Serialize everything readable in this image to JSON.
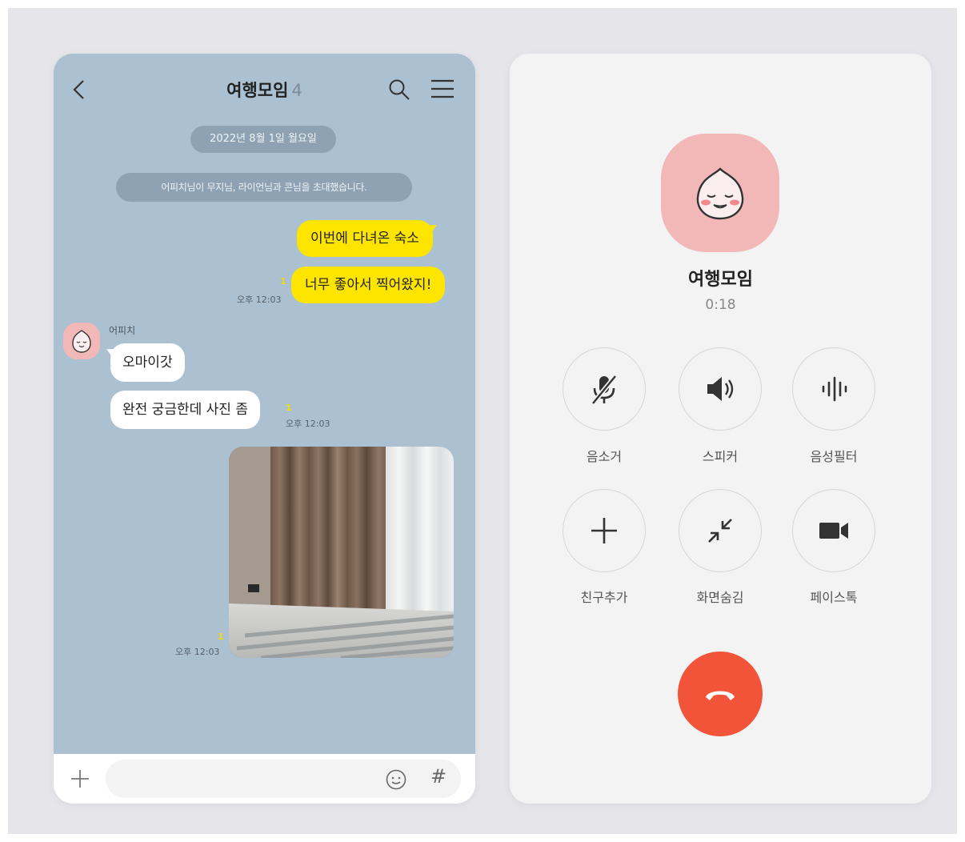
{
  "chat": {
    "title": "여행모임",
    "member_count": "4",
    "date_divider": "2022년 8월 1일 월요일",
    "notice": "어피치님이 무지님, 라이언님과 콘님을 초대했습니다.",
    "messages": {
      "me1": {
        "text": "이번에 다녀온 숙소"
      },
      "me2": {
        "text": "너무 좋아서 찍어왔지!",
        "unread": "1",
        "time": "오후 12:03"
      },
      "sender_name": "어피치",
      "you1": {
        "text": "오마이갓"
      },
      "you2": {
        "text": "완전 궁금한데 사진 좀",
        "unread": "1",
        "time": "오후 12:03"
      },
      "photo": {
        "unread": "1",
        "time": "오후 12:03"
      }
    },
    "input": {
      "placeholder": "",
      "hash": "#"
    }
  },
  "call": {
    "name": "여행모임",
    "timer": "0:18",
    "controls": [
      {
        "label": "음소거",
        "icon": "mic-off-icon"
      },
      {
        "label": "스피커",
        "icon": "speaker-icon"
      },
      {
        "label": "음성필터",
        "icon": "voice-filter-icon"
      },
      {
        "label": "친구추가",
        "icon": "plus-icon"
      },
      {
        "label": "화면숨김",
        "icon": "minimize-icon"
      },
      {
        "label": "페이스톡",
        "icon": "video-icon"
      }
    ],
    "hangup_color": "#f2543a"
  },
  "colors": {
    "chat_bg": "#abc1d1",
    "my_bubble": "#fee500",
    "avatar_pink": "#f2b8b7"
  }
}
